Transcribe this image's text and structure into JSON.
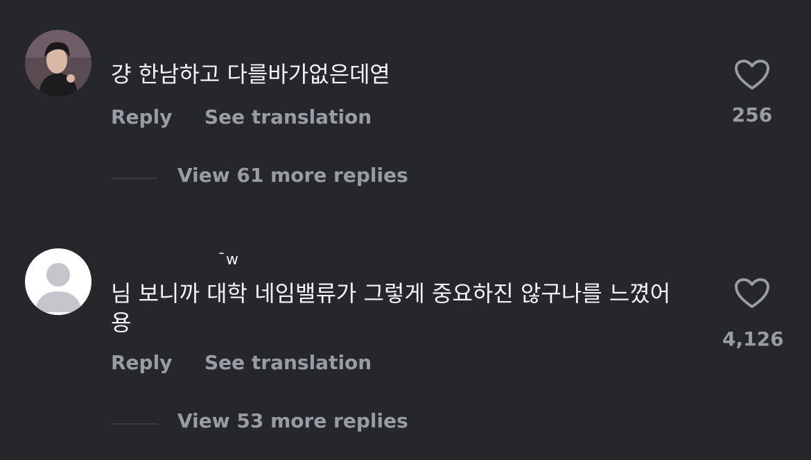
{
  "comments": [
    {
      "username": "",
      "text": "걍 한남하고 다를바가없은데엳",
      "reply_label": "Reply",
      "translate_label": "See translation",
      "like_count": "256",
      "view_replies_label": "View 61 more replies"
    },
    {
      "username": "¯w",
      "text": "님 보니까 대학 네임밸류가 그렇게 중요하진 않구나를 느꼈어용",
      "reply_label": "Reply",
      "translate_label": "See translation",
      "like_count": "4,126",
      "view_replies_label": "View 53 more replies"
    }
  ],
  "colors": {
    "background": "#25272b",
    "text_primary": "#f4f4f4",
    "text_secondary": "#9a9ca3",
    "divider": "#3a3c41",
    "default_avatar_bg": "#ffffff",
    "default_avatar_fg": "#c4c6cb"
  },
  "icons": {
    "like": "heart-outline-icon",
    "default_avatar": "person-silhouette-icon"
  }
}
